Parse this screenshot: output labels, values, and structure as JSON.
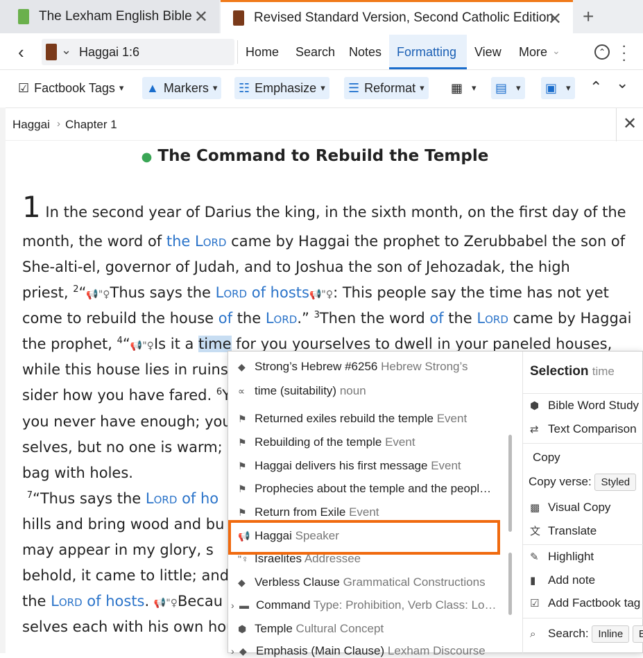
{
  "tabs": [
    {
      "label": "The Lexham English Bible",
      "icon_color": "#6ab04c"
    },
    {
      "label": "Revised Standard Version, Second Catholic Edition",
      "icon_color": "#7a3a1a"
    }
  ],
  "nav": {
    "reference": "Haggai 1:6",
    "menu": [
      "Home",
      "Search",
      "Notes",
      "Formatting",
      "View",
      "More"
    ]
  },
  "toolbar": {
    "factbook": "Factbook Tags",
    "markers": "Markers",
    "emphasize": "Emphasize",
    "reformat": "Reformat"
  },
  "breadcrumb": {
    "book": "Haggai",
    "sep": "›",
    "chapter": "Chapter 1"
  },
  "article": {
    "title": "The Command to Rebuild the Temple",
    "chapter_num": "1"
  },
  "popup": {
    "items": [
      {
        "label": "Strong’s Hebrew #6256",
        "sub": "Hebrew Strong’s",
        "icon": "diamond-icon"
      },
      {
        "label": "time (suitability)",
        "sub": "noun",
        "icon": "lemma-icon"
      },
      {
        "label": "Returned exiles rebuild the temple",
        "sub": "Event",
        "icon": "flag-icon"
      },
      {
        "label": "Rebuilding of the temple",
        "sub": "Event",
        "icon": "flag-icon"
      },
      {
        "label": "Haggai delivers his first message",
        "sub": "Event",
        "icon": "flag-icon"
      },
      {
        "label": "Prophecies about the temple and the peopl…",
        "sub": "",
        "icon": "flag-icon"
      },
      {
        "label": "Return from Exile",
        "sub": "Event",
        "icon": "flag-icon"
      },
      {
        "label": "Haggai",
        "sub": "Speaker",
        "icon": "speaker-icon"
      },
      {
        "label": "Israelites",
        "sub": "Addressee",
        "icon": "addressee-icon"
      },
      {
        "label": "Verbless Clause",
        "sub": "Grammatical Constructions",
        "icon": "diamond-icon"
      },
      {
        "label": "Command",
        "sub": "Type: Prohibition, Verb Class: Lo…",
        "icon": "tag-icon"
      },
      {
        "label": "Temple",
        "sub": "Cultural Concept",
        "icon": "shield-icon"
      },
      {
        "label": "Emphasis (Main Clause)",
        "sub": "Lexham Discourse",
        "icon": "diamond-icon"
      }
    ],
    "selection_label": "Selection",
    "selection_word": "time",
    "actions": {
      "word_study": "Bible Word Study",
      "text_comparison": "Text Comparison",
      "copy": "Copy",
      "copy_verse": "Copy verse:",
      "styled": "Styled",
      "visual_copy": "Visual Copy",
      "translate": "Translate",
      "highlight": "Highlight",
      "add_note": "Add note",
      "add_factbook": "Add Factbook tag",
      "search": "Search:",
      "inline": "Inline",
      "b": "B"
    }
  }
}
